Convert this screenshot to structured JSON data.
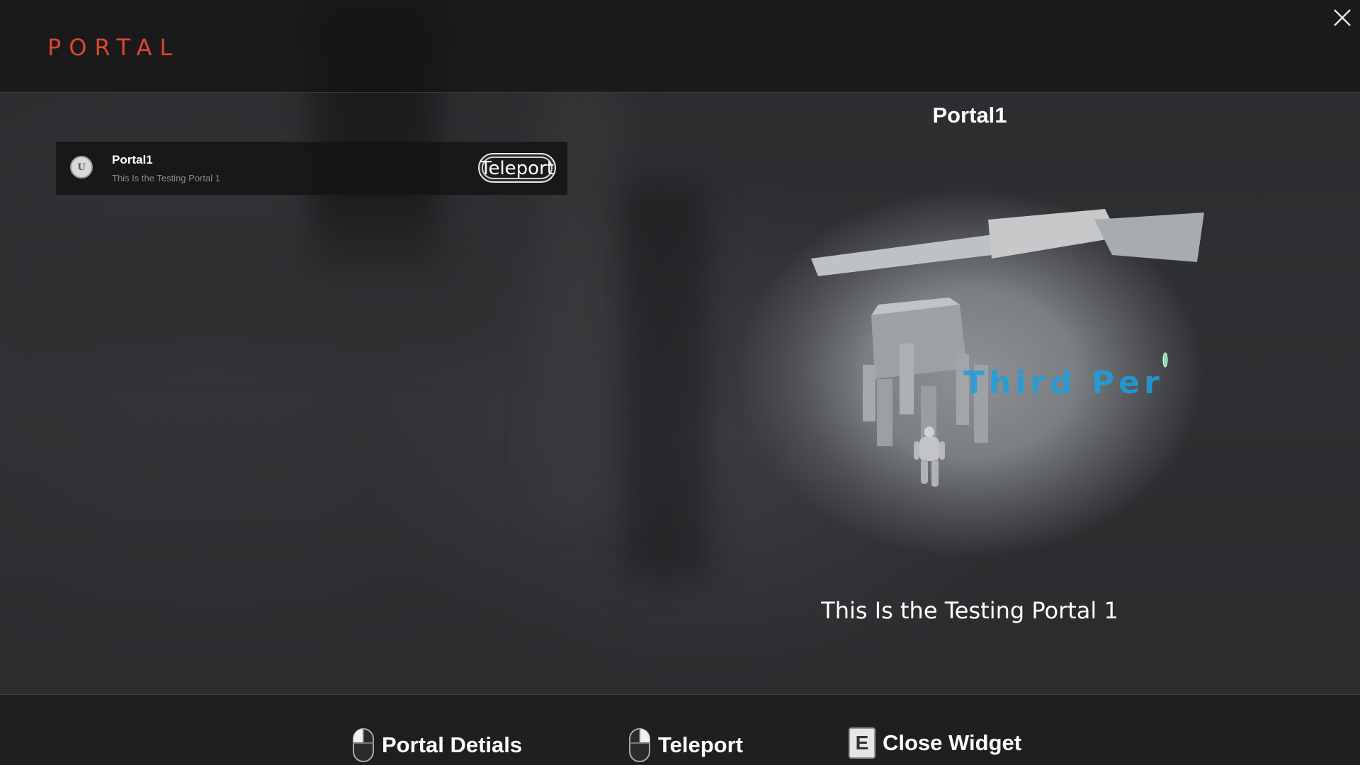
{
  "header": {
    "title": "PORTAL"
  },
  "portal_list": {
    "items": [
      {
        "name": "Portal1",
        "description": "This Is the Testing Portal 1",
        "action_label": "Teleport",
        "logo_text": "U"
      }
    ]
  },
  "details": {
    "title": "Portal1",
    "description": "This Is the Testing Portal 1",
    "preview_overlay_text": "Third Per"
  },
  "footer": {
    "hints": [
      {
        "icon": "mouse-left-icon",
        "label": "Portal Detials"
      },
      {
        "icon": "mouse-right-icon",
        "label": "Teleport"
      },
      {
        "icon": "key-e-icon",
        "key": "E",
        "label": "Close Widget"
      }
    ]
  },
  "colors": {
    "accent": "#d9482c",
    "text": "#ffffff",
    "panel": "#141415"
  }
}
